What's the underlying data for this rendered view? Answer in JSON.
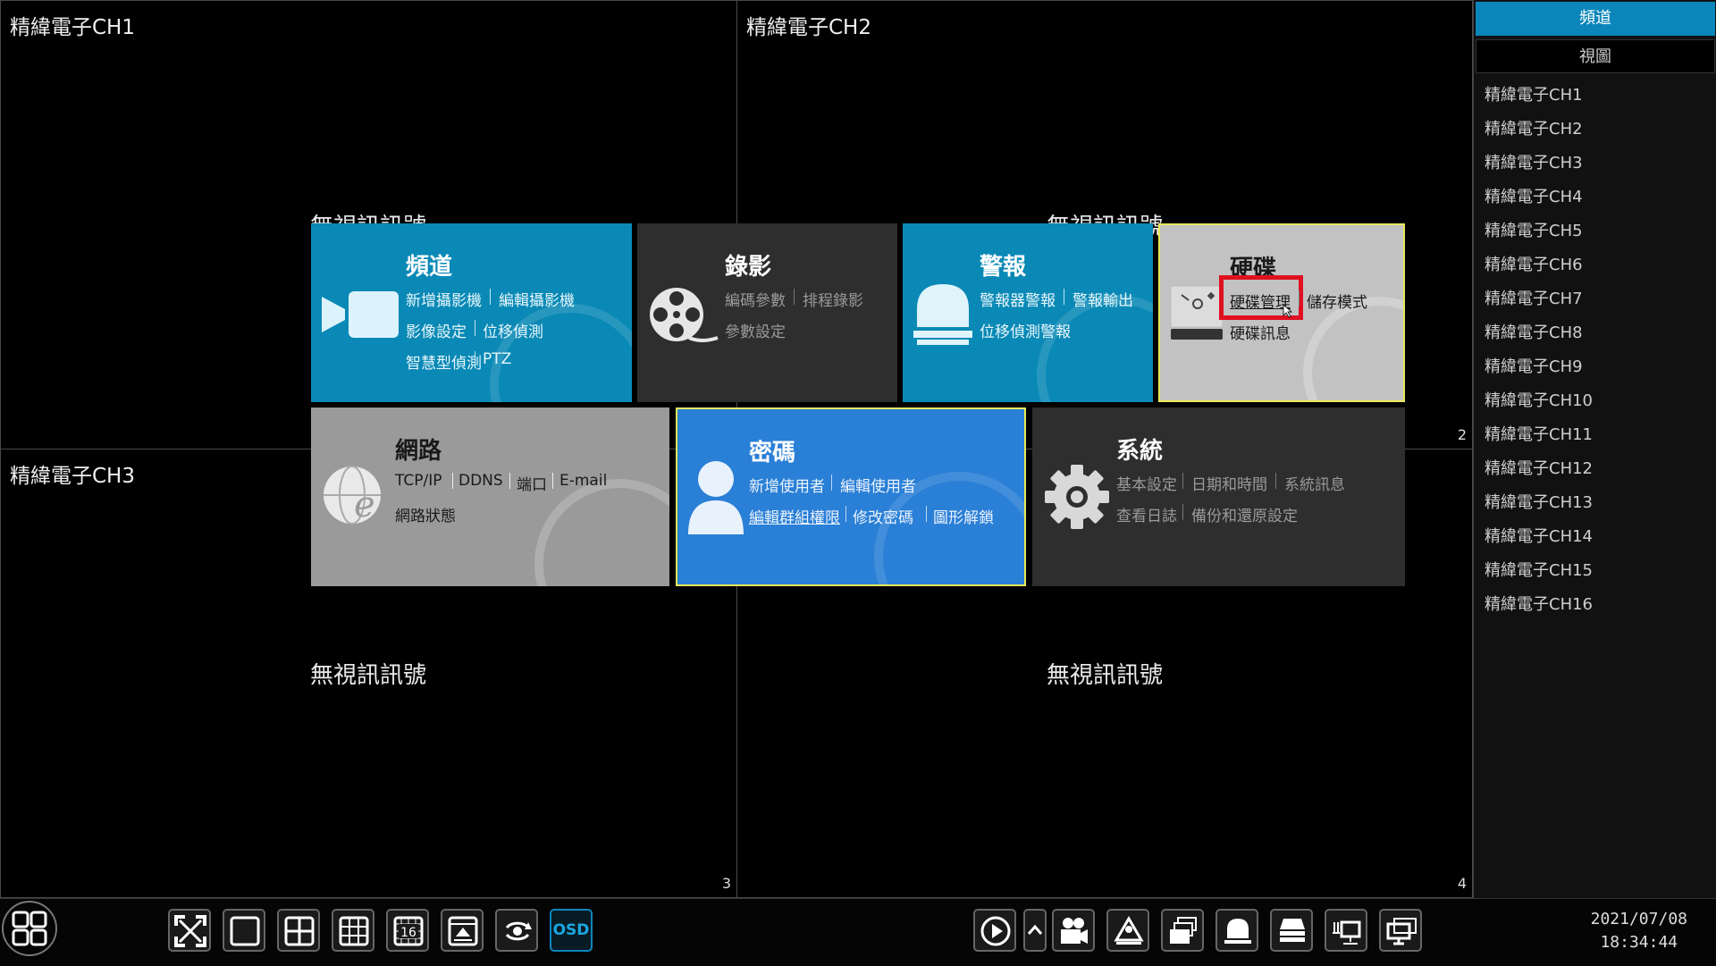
{
  "cells": [
    {
      "title": "精緯電子CH1",
      "no_signal": "無視訊訊號",
      "num": ""
    },
    {
      "title": "精緯電子CH2",
      "no_signal": "無視訊訊號",
      "num": "2"
    },
    {
      "title": "精緯電子CH3",
      "no_signal": "無視訊訊號",
      "num": "3"
    },
    {
      "title": "",
      "no_signal": "無視訊訊號",
      "num": "4"
    }
  ],
  "sidebar": {
    "tabs": [
      "頻道",
      "視圖"
    ],
    "channels": [
      "精緯電子CH1",
      "精緯電子CH2",
      "精緯電子CH3",
      "精緯電子CH4",
      "精緯電子CH5",
      "精緯電子CH6",
      "精緯電子CH7",
      "精緯電子CH8",
      "精緯電子CH9",
      "精緯電子CH10",
      "精緯電子CH11",
      "精緯電子CH12",
      "精緯電子CH13",
      "精緯電子CH14",
      "精緯電子CH15",
      "精緯電子CH16"
    ]
  },
  "menu": {
    "channel": {
      "title": "頻道",
      "links": [
        "新增攝影機",
        "編輯攝影機",
        "影像設定",
        "位移偵測",
        "智慧型偵測",
        "PTZ"
      ],
      "icon": "camera-icon"
    },
    "record": {
      "title": "錄影",
      "links": [
        "編碼參數",
        "排程錄影",
        "參數設定"
      ],
      "icon": "film-reel-icon"
    },
    "alarm": {
      "title": "警報",
      "links": [
        "警報器警報",
        "警報輸出",
        "位移偵測警報"
      ],
      "icon": "alarm-light-icon"
    },
    "disk": {
      "title": "硬碟",
      "links": [
        "硬碟管理",
        "儲存模式",
        "硬碟訊息"
      ],
      "icon": "hard-disk-icon"
    },
    "network": {
      "title": "網路",
      "links": [
        "TCP/IP",
        "DDNS",
        "端口",
        "E-mail",
        "網路狀態"
      ],
      "icon": "network-globe-icon"
    },
    "password": {
      "title": "密碼",
      "links": [
        "新增使用者",
        "編輯使用者",
        "編輯群組權限",
        "修改密碼",
        "圖形解鎖"
      ],
      "icon": "user-icon"
    },
    "system": {
      "title": "系統",
      "links": [
        "基本設定",
        "日期和時間",
        "系統訊息",
        "查看日誌",
        "備份和還原設定"
      ],
      "icon": "gear-icon"
    }
  },
  "toolbar": {
    "osd_label": "OSD",
    "num16": "16"
  },
  "clock": {
    "date": "2021/07/08",
    "time": "18:34:44"
  },
  "colors": {
    "accent": "#0b86ba",
    "highlight_red": "#e01020",
    "selected_border": "#e8e85a"
  }
}
